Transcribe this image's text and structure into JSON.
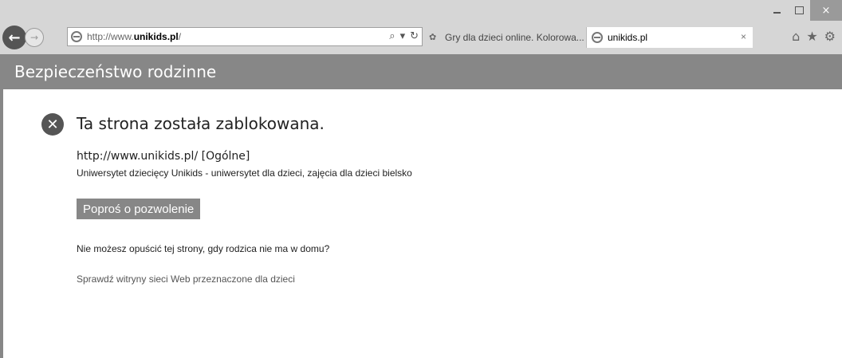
{
  "browser": {
    "address": {
      "prefix": "http://www.",
      "domain": "unikids.pl",
      "suffix": "/"
    },
    "search_icon": "search-icon",
    "tabs": [
      {
        "label": "Gry dla dzieci online. Kolorowa...",
        "icon": "kids-site-favicon"
      },
      {
        "label": "unikids.pl",
        "icon": "ie-page-icon"
      }
    ],
    "window_controls": {
      "minimize": "–",
      "maximize": "□",
      "close": "×"
    }
  },
  "page": {
    "header_title": "Bezpieczeństwo rodzinne",
    "blocked_title": "Ta strona została zablokowana.",
    "blocked_url": "http://www.unikids.pl/ [Ogólne]",
    "blocked_description": "Uniwersytet dziecięcy Unikids - uniwersytet dla dzieci, zajęcia dla dzieci bielsko",
    "ask_button": "Poproś o pozwolenie",
    "question": "Nie możesz opuścić tej strony, gdy rodzica nie ma w domu?",
    "kids_link": "Sprawdź witryny sieci Web przeznaczone dla dzieci"
  },
  "colors": {
    "header_bg": "#878787",
    "chrome_bg": "#d6d6d6"
  }
}
